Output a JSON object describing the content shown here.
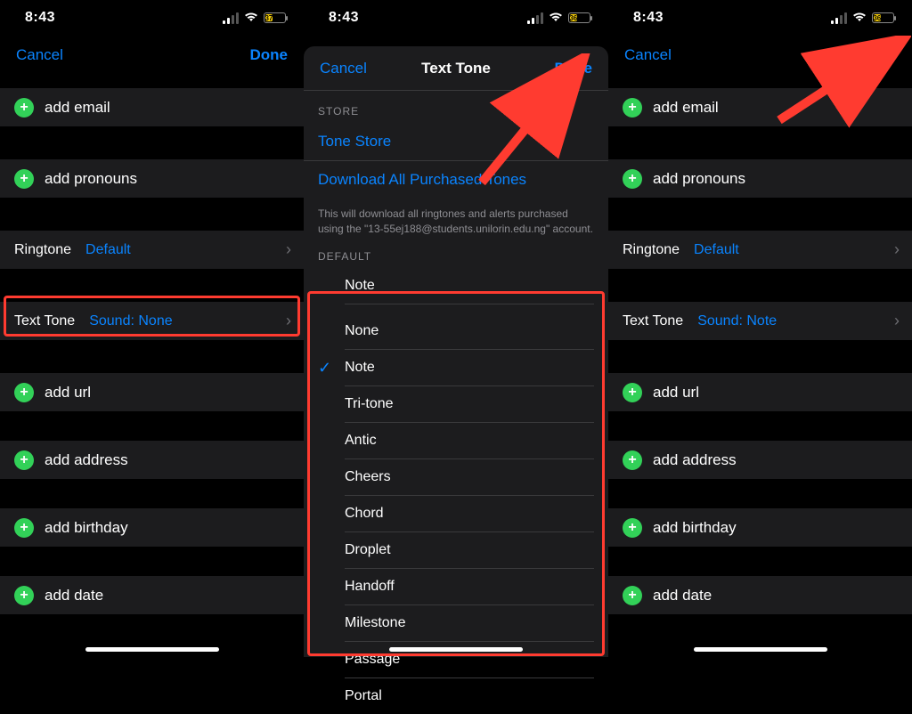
{
  "status": {
    "time": "8:43",
    "battery": [
      "37",
      "36",
      "36"
    ]
  },
  "nav": {
    "cancel": "Cancel",
    "done": "Done",
    "sheet_title": "Text Tone"
  },
  "contact_edit": {
    "add_email": "add email",
    "add_pronouns": "add pronouns",
    "add_url": "add url",
    "add_address": "add address",
    "add_birthday": "add birthday",
    "add_date": "add date",
    "ringtone_label": "Ringtone",
    "ringtone_value": "Default",
    "texttone_label": "Text Tone",
    "texttone_value_before": "Sound: None",
    "texttone_value_after": "Sound: Note"
  },
  "store": {
    "header": "Store",
    "tone_store": "Tone Store",
    "download_all": "Download All Purchased Tones",
    "footer": "This will download all ringtones and alerts purchased using the \"13-55ej188@students.unilorin.edu.ng\" account."
  },
  "default_section": {
    "header": "Default",
    "top_tone": "Note",
    "selected": "Note",
    "tones": [
      "None",
      "Note",
      "Tri-tone",
      "Antic",
      "Cheers",
      "Chord",
      "Droplet",
      "Handoff",
      "Milestone",
      "Passage",
      "Portal"
    ]
  }
}
